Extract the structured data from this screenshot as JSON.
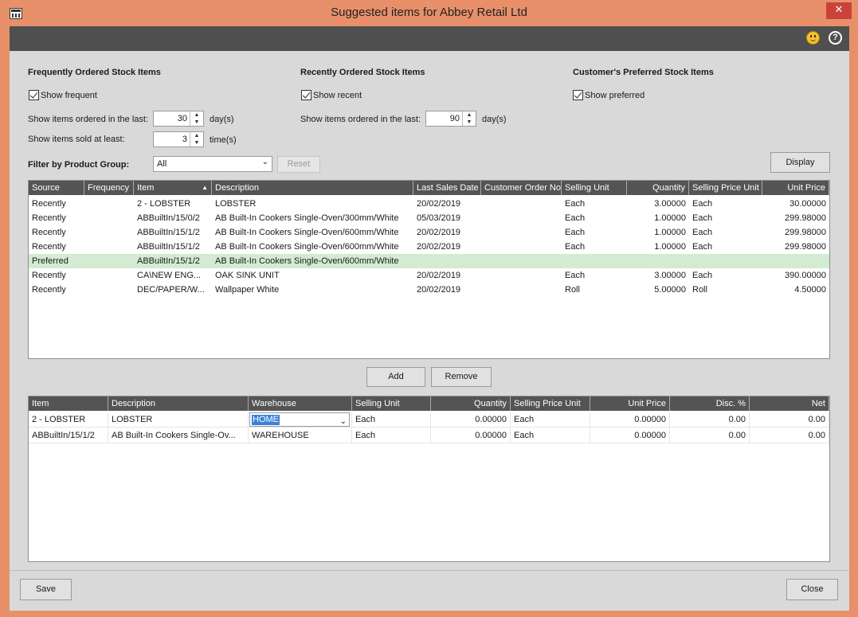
{
  "window": {
    "title": "Suggested items for Abbey Retail Ltd",
    "close_glyph": "✕"
  },
  "topbar": {
    "smiley_icon": "smiley-face-icon",
    "help_icon": "help-icon",
    "help_glyph": "?"
  },
  "frequent": {
    "title": "Frequently Ordered Stock Items",
    "show_label": "Show frequent",
    "ordered_label": "Show items ordered in the last:",
    "ordered_value": "30",
    "ordered_unit": "day(s)",
    "sold_label": "Show items sold at least:",
    "sold_value": "3",
    "sold_unit": "time(s)"
  },
  "recent": {
    "title": "Recently Ordered Stock Items",
    "show_label": "Show recent",
    "ordered_label": "Show items ordered in the last:",
    "ordered_value": "90",
    "ordered_unit": "day(s)"
  },
  "preferred": {
    "title": "Customer's Preferred Stock Items",
    "show_label": "Show preferred"
  },
  "filter": {
    "label": "Filter by Product Group:",
    "value": "All",
    "reset_label": "Reset",
    "display_label": "Display"
  },
  "suggest_grid": {
    "headers": [
      "Source",
      "Frequency",
      "Item",
      "Description",
      "Last Sales Date",
      "Customer Order No",
      "Selling Unit",
      "Quantity",
      "Selling Price Unit",
      "Unit Price"
    ],
    "sort_arrow": "▲",
    "rows": [
      {
        "source": "Recently",
        "frequency": "",
        "item": "2 - LOBSTER",
        "description": "LOBSTER",
        "last_sales": "20/02/2019",
        "order_no": "",
        "unit": "Each",
        "qty": "3.00000",
        "price_unit": "Each",
        "price": "30.00000"
      },
      {
        "source": "Recently",
        "frequency": "",
        "item": "ABBuiltIn/15/0/2",
        "description": "AB Built-In Cookers Single-Oven/300mm/White",
        "last_sales": "05/03/2019",
        "order_no": "",
        "unit": "Each",
        "qty": "1.00000",
        "price_unit": "Each",
        "price": "299.98000"
      },
      {
        "source": "Recently",
        "frequency": "",
        "item": "ABBuiltIn/15/1/2",
        "description": "AB Built-In Cookers Single-Oven/600mm/White",
        "last_sales": "20/02/2019",
        "order_no": "",
        "unit": "Each",
        "qty": "1.00000",
        "price_unit": "Each",
        "price": "299.98000"
      },
      {
        "source": "Recently",
        "frequency": "",
        "item": "ABBuiltIn/15/1/2",
        "description": "AB Built-In Cookers Single-Oven/600mm/White",
        "last_sales": "20/02/2019",
        "order_no": "",
        "unit": "Each",
        "qty": "1.00000",
        "price_unit": "Each",
        "price": "299.98000"
      },
      {
        "source": "Preferred",
        "frequency": "",
        "item": "ABBuiltIn/15/1/2",
        "description": "AB Built-In Cookers Single-Oven/600mm/White",
        "last_sales": "",
        "order_no": "",
        "unit": "",
        "qty": "",
        "price_unit": "",
        "price": ""
      },
      {
        "source": "Recently",
        "frequency": "",
        "item": "CA\\NEW ENG...",
        "description": "OAK SINK UNIT",
        "last_sales": "20/02/2019",
        "order_no": "",
        "unit": "Each",
        "qty": "3.00000",
        "price_unit": "Each",
        "price": "390.00000"
      },
      {
        "source": "Recently",
        "frequency": "",
        "item": "DEC/PAPER/W...",
        "description": "Wallpaper White",
        "last_sales": "20/02/2019",
        "order_no": "",
        "unit": "Roll",
        "qty": "5.00000",
        "price_unit": "Roll",
        "price": "4.50000"
      }
    ]
  },
  "actions": {
    "add_label": "Add",
    "remove_label": "Remove"
  },
  "order_grid": {
    "headers": [
      "Item",
      "Description",
      "Warehouse",
      "Selling Unit",
      "Quantity",
      "Selling Price Unit",
      "Unit Price",
      "Disc. %",
      "Net"
    ],
    "rows": [
      {
        "item": "2 - LOBSTER",
        "description": "LOBSTER",
        "warehouse": "HOME",
        "unit": "Each",
        "qty": "0.00000",
        "price_unit": "Each",
        "price": "0.00000",
        "disc": "0.00",
        "net": "0.00"
      },
      {
        "item": "ABBuiltIn/15/1/2",
        "description": "AB Built-In Cookers Single-Ov...",
        "warehouse": "WAREHOUSE",
        "unit": "Each",
        "qty": "0.00000",
        "price_unit": "Each",
        "price": "0.00000",
        "disc": "0.00",
        "net": "0.00"
      }
    ]
  },
  "footer": {
    "save_label": "Save",
    "close_label": "Close"
  },
  "colors": {
    "title_bar": "#e7906a",
    "close_btn": "#c9433a",
    "grid_header": "#545454",
    "selected_row": "#d2ebd2",
    "highlight": "#3b82d6"
  }
}
